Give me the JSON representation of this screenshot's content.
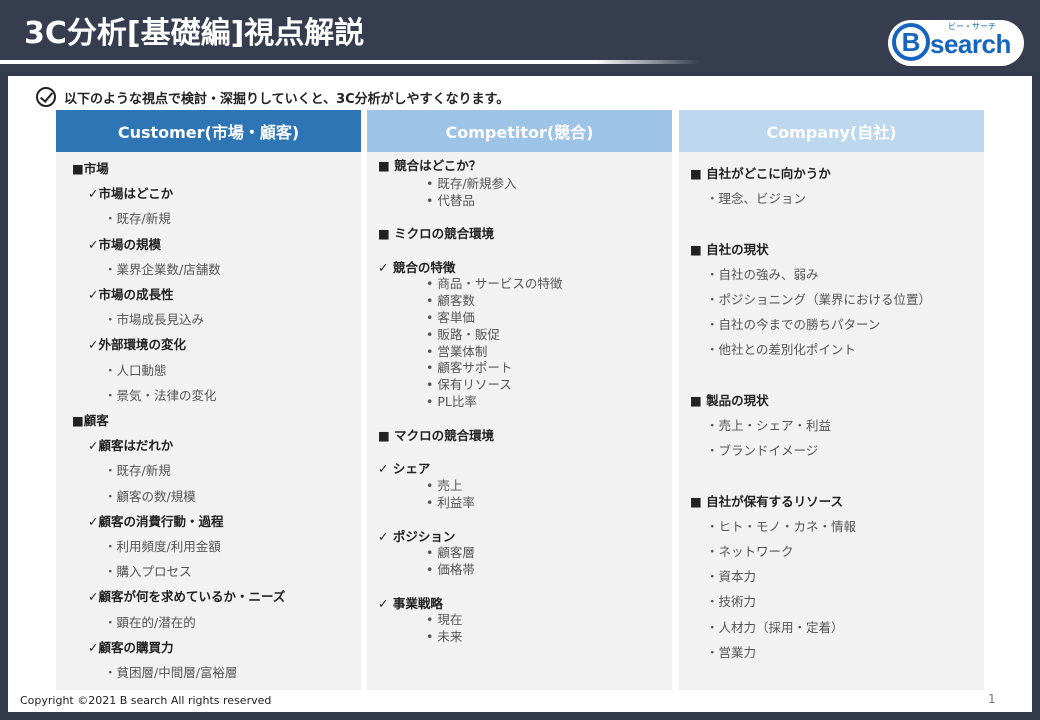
{
  "header": {
    "title": "3C分析[基礎編]視点解説",
    "logo_text": "search",
    "logo_letter": "B",
    "logo_kana": "ビー・サーチ"
  },
  "intro": "以下のような視点で検討・深掘りしていくと、3C分析がしやすくなります。",
  "columns": [
    {
      "title": "Customer(市場・顧客)",
      "lines": [
        {
          "kind": "h",
          "text": "■市場"
        },
        {
          "kind": "s",
          "text": "✓市場はどこか"
        },
        {
          "kind": "d",
          "text": "・既存/新規"
        },
        {
          "kind": "s",
          "text": "✓市場の規模"
        },
        {
          "kind": "d",
          "text": "・業界企業数/店舗数"
        },
        {
          "kind": "s",
          "text": "✓市場の成長性"
        },
        {
          "kind": "d",
          "text": "・市場成長見込み"
        },
        {
          "kind": "s",
          "text": "✓外部環境の変化"
        },
        {
          "kind": "d",
          "text": "・人口動態"
        },
        {
          "kind": "d",
          "text": "・景気・法律の変化"
        },
        {
          "kind": "h",
          "text": "■顧客"
        },
        {
          "kind": "s",
          "text": "✓顧客はだれか"
        },
        {
          "kind": "d",
          "text": "・既存/新規"
        },
        {
          "kind": "d",
          "text": "・顧客の数/規模"
        },
        {
          "kind": "s",
          "text": "✓顧客の消費行動・過程"
        },
        {
          "kind": "d",
          "text": "・利用頻度/利用金額"
        },
        {
          "kind": "d",
          "text": "・購入プロセス"
        },
        {
          "kind": "s",
          "text": "✓顧客が何を求めているか・ニーズ"
        },
        {
          "kind": "d",
          "text": "・顕在的/潜在的"
        },
        {
          "kind": "s",
          "text": "✓顧客の購買力"
        },
        {
          "kind": "d",
          "text": "・貧困層/中間層/富裕層"
        }
      ]
    },
    {
      "title": "Competitor(競合)",
      "lines": [
        {
          "kind": "h",
          "text": "■ 競合はどこか？"
        },
        {
          "kind": "d",
          "text": "• 既存/新規参入"
        },
        {
          "kind": "d",
          "text": "• 代替品"
        },
        {
          "kind": "h",
          "text": "■ ミクロの競合環境"
        },
        {
          "kind": "h",
          "text": "✓ 競合の特徴"
        },
        {
          "kind": "d",
          "text": "• 商品・サービスの特徴"
        },
        {
          "kind": "d",
          "text": "• 顧客数"
        },
        {
          "kind": "d",
          "text": "• 客単価"
        },
        {
          "kind": "d",
          "text": "• 販路・販促"
        },
        {
          "kind": "d",
          "text": "• 営業体制"
        },
        {
          "kind": "d",
          "text": "• 顧客サポート"
        },
        {
          "kind": "d",
          "text": "• 保有リソース"
        },
        {
          "kind": "d",
          "text": "• PL比率"
        },
        {
          "kind": "h",
          "text": "■ マクロの競合環境"
        },
        {
          "kind": "h",
          "text": "✓ シェア"
        },
        {
          "kind": "d",
          "text": "• 売上"
        },
        {
          "kind": "d",
          "text": "• 利益率"
        },
        {
          "kind": "h",
          "text": "✓ ポジション"
        },
        {
          "kind": "d",
          "text": "• 顧客層"
        },
        {
          "kind": "d",
          "text": "• 価格帯"
        },
        {
          "kind": "h",
          "text": "✓ 事業戦略"
        },
        {
          "kind": "d",
          "text": "• 現在"
        },
        {
          "kind": "d",
          "text": "• 未来"
        }
      ]
    },
    {
      "title": "Company(自社)",
      "lines": [
        {
          "kind": "h",
          "text": "■ 自社がどこに向かうか"
        },
        {
          "kind": "d",
          "text": "・理念、ビジョン"
        },
        {
          "kind": "h",
          "text": "■ 自社の現状"
        },
        {
          "kind": "d",
          "text": "・自社の強み、弱み"
        },
        {
          "kind": "d",
          "text": "・ポジショニング（業界における位置）"
        },
        {
          "kind": "d",
          "text": "・自社の今までの勝ちパターン"
        },
        {
          "kind": "d",
          "text": "・他社との差別化ポイント"
        },
        {
          "kind": "h",
          "text": "■ 製品の現状"
        },
        {
          "kind": "d",
          "text": "・売上・シェア・利益"
        },
        {
          "kind": "d",
          "text": "・ブランドイメージ"
        },
        {
          "kind": "h",
          "text": "■ 自社が保有するリソース"
        },
        {
          "kind": "d",
          "text": "・ヒト・モノ・カネ・情報"
        },
        {
          "kind": "d",
          "text": "・ネットワーク"
        },
        {
          "kind": "d",
          "text": "・資本力"
        },
        {
          "kind": "d",
          "text": "・技術力"
        },
        {
          "kind": "d",
          "text": "・人材力（採用・定着）"
        },
        {
          "kind": "d",
          "text": "・営業力"
        }
      ]
    }
  ],
  "footer": {
    "copyright": "Copyright ©2021 B search All rights reserved",
    "page_number": "1"
  },
  "colors": {
    "header_bg": "#353d4f",
    "customer_head": "#2e75b6",
    "competitor_head": "#9dc3e6",
    "company_head": "#bdd7ee",
    "column_body": "#f2f2f2",
    "logo_blue": "#1565c0"
  }
}
